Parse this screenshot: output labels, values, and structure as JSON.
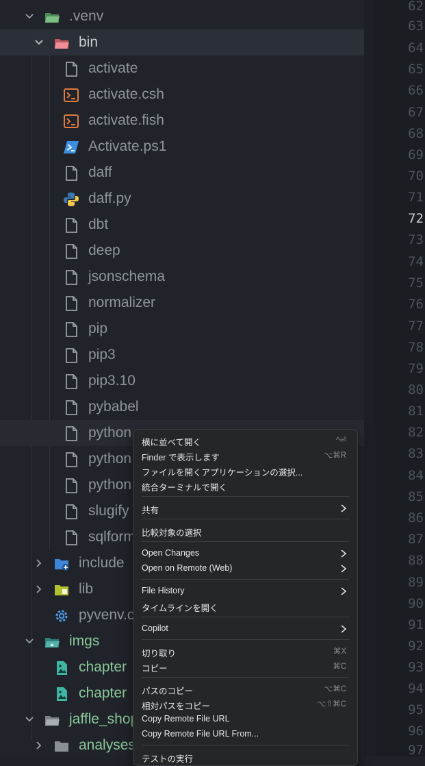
{
  "explorer": {
    "tree": [
      {
        "label": ".venv",
        "icon": "folder-open-icon",
        "tone": "dim"
      },
      {
        "label": "bin",
        "icon": "folder-open-icon",
        "tone": "bright"
      },
      {
        "label": "activate",
        "icon": "file-icon",
        "tone": "dim"
      },
      {
        "label": "activate.csh",
        "icon": "terminal-icon",
        "tone": "dim"
      },
      {
        "label": "activate.fish",
        "icon": "terminal-icon",
        "tone": "dim"
      },
      {
        "label": "Activate.ps1",
        "icon": "powershell-icon",
        "tone": "dim"
      },
      {
        "label": "daff",
        "icon": "file-icon",
        "tone": "dim"
      },
      {
        "label": "daff.py",
        "icon": "python-icon",
        "tone": "dim"
      },
      {
        "label": "dbt",
        "icon": "file-icon",
        "tone": "dim"
      },
      {
        "label": "deep",
        "icon": "file-icon",
        "tone": "dim"
      },
      {
        "label": "jsonschema",
        "icon": "file-icon",
        "tone": "dim"
      },
      {
        "label": "normalizer",
        "icon": "file-icon",
        "tone": "dim"
      },
      {
        "label": "pip",
        "icon": "file-icon",
        "tone": "dim"
      },
      {
        "label": "pip3",
        "icon": "file-icon",
        "tone": "dim"
      },
      {
        "label": "pip3.10",
        "icon": "file-icon",
        "tone": "dim"
      },
      {
        "label": "pybabel",
        "icon": "file-icon",
        "tone": "dim"
      },
      {
        "label": "python",
        "icon": "file-icon",
        "tone": "dim"
      },
      {
        "label": "python",
        "icon": "file-icon",
        "tone": "dim"
      },
      {
        "label": "python",
        "icon": "file-icon",
        "tone": "dim"
      },
      {
        "label": "slugify",
        "icon": "file-icon",
        "tone": "dim"
      },
      {
        "label": "sqlformat",
        "icon": "file-icon",
        "tone": "dim"
      },
      {
        "label": "include",
        "icon": "folder-include-icon",
        "tone": "dim"
      },
      {
        "label": "lib",
        "icon": "folder-lib-icon",
        "tone": "dim"
      },
      {
        "label": "pyvenv.cfg",
        "icon": "gear-icon",
        "tone": "dim"
      },
      {
        "label": "imgs",
        "icon": "folder-images-icon",
        "tone": "green"
      },
      {
        "label": "chapter",
        "icon": "image-file-icon",
        "tone": "green"
      },
      {
        "label": "chapter",
        "icon": "image-file-icon",
        "tone": "green"
      },
      {
        "label": "jaffle_shop",
        "icon": "folder-open-icon",
        "tone": "green"
      },
      {
        "label": "analyses",
        "icon": "folder-icon",
        "tone": "green"
      }
    ]
  },
  "gutter": {
    "line_numbers": [
      "62",
      "63",
      "64",
      "65",
      "66",
      "67",
      "68",
      "69",
      "70",
      "71",
      "72",
      "73",
      "74",
      "75",
      "76",
      "77",
      "78",
      "79",
      "80",
      "81",
      "82",
      "83",
      "84",
      "85",
      "86",
      "87",
      "88",
      "89",
      "90",
      "91",
      "92",
      "93",
      "94",
      "95",
      "96",
      "97"
    ],
    "current_line": "72"
  },
  "context_menu": {
    "items": [
      {
        "label": "横に並べて開く",
        "shortcut": "^⏎"
      },
      {
        "label": "Finder で表示します",
        "shortcut": "⌥⌘R"
      },
      {
        "label": "ファイルを開くアプリケーションの選択...",
        "shortcut": ""
      },
      {
        "label": "統合ターミナルで開く",
        "shortcut": ""
      },
      {
        "label": "共有",
        "submenu": true
      },
      {
        "label": "比較対象の選択",
        "shortcut": ""
      },
      {
        "label": "Open Changes",
        "submenu": true
      },
      {
        "label": "Open on Remote (Web)",
        "submenu": true
      },
      {
        "label": "File History",
        "submenu": true
      },
      {
        "label": "タイムラインを開く",
        "shortcut": ""
      },
      {
        "label": "Copilot",
        "submenu": true
      },
      {
        "label": "切り取り",
        "shortcut": "⌘X"
      },
      {
        "label": "コピー",
        "shortcut": "⌘C"
      },
      {
        "label": "パスのコピー",
        "shortcut": "⌥⌘C"
      },
      {
        "label": "相対パスをコピー",
        "shortcut": "⌥⇧⌘C"
      },
      {
        "label": "Copy Remote File URL",
        "shortcut": ""
      },
      {
        "label": "Copy Remote File URL From...",
        "shortcut": ""
      },
      {
        "label": "テストの実行",
        "shortcut": ""
      }
    ]
  }
}
